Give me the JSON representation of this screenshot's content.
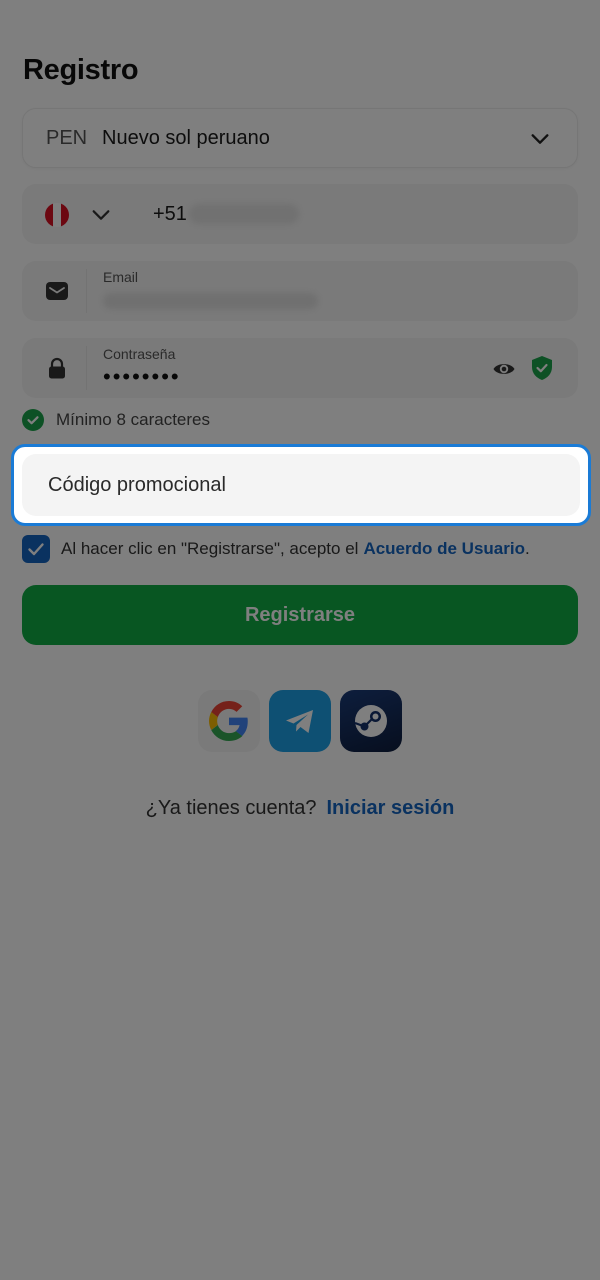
{
  "header": {
    "title": "Registro"
  },
  "currency": {
    "code": "PEN",
    "name": "Nuevo sol peruano"
  },
  "phone": {
    "prefix": "+51"
  },
  "email": {
    "label": "Email"
  },
  "password": {
    "label": "Contraseña",
    "masked_value": "••••••••"
  },
  "password_hint": "Mínimo 8 caracteres",
  "promo": {
    "placeholder": "Código promocional"
  },
  "agreement": {
    "text": "Al hacer clic en \"Registrarse\", acepto el",
    "link": "Acuerdo de Usuario",
    "end": ".",
    "checked": true
  },
  "register_button": "Registrarse",
  "social": [
    "google-icon",
    "telegram-icon",
    "steam-icon"
  ],
  "login": {
    "question": "¿Ya tienes cuenta?",
    "link": "Iniciar sesión"
  },
  "colors": {
    "accent": "#1565c0",
    "primary_button": "#10ad45",
    "highlight_border": "#1a7bd6",
    "success": "#1aa34a"
  }
}
